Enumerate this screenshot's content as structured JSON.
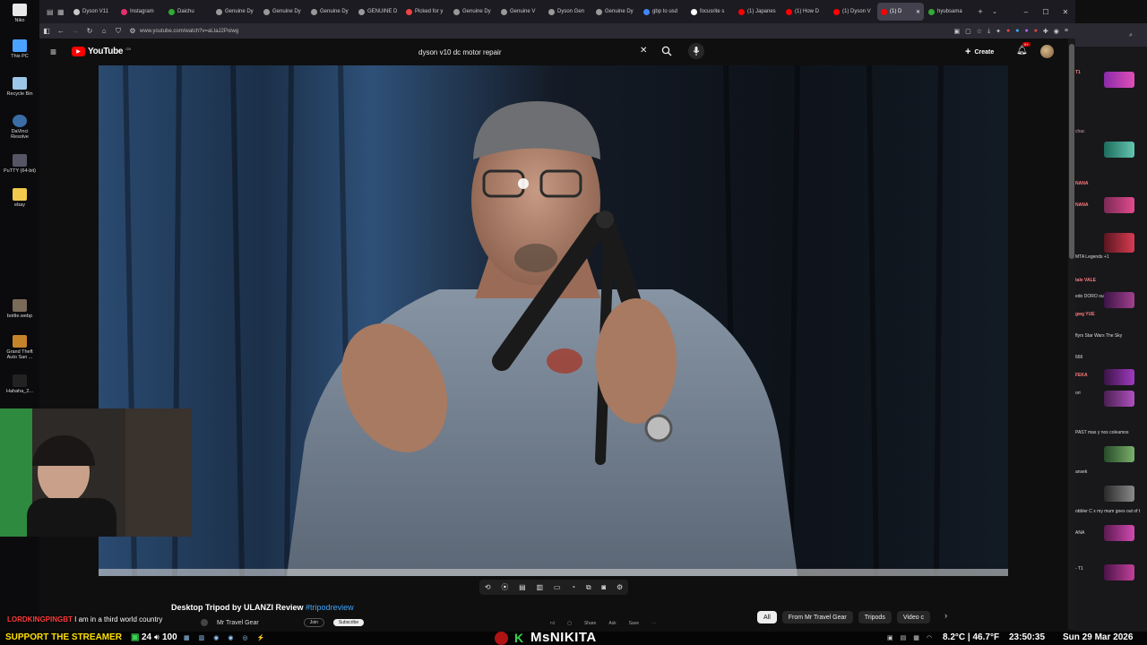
{
  "desktop": {
    "icons": [
      {
        "label": "Niko"
      },
      {
        "label": "This PC"
      },
      {
        "label": "Recycle Bin"
      },
      {
        "label": "DaVinci Resolve"
      },
      {
        "label": "PuTTY (64-bit)"
      },
      {
        "label": "ebay"
      },
      {
        "label": "bottle.webp"
      },
      {
        "label": "Grand Theft Auto San ..."
      },
      {
        "label": "Hahaha_2..."
      }
    ]
  },
  "browser": {
    "tabs": [
      {
        "label": "Dyson V11"
      },
      {
        "label": "Instagram"
      },
      {
        "label": "Daichu"
      },
      {
        "label": "Genuine Dy"
      },
      {
        "label": "Genuine Dy"
      },
      {
        "label": "Genuine Dy"
      },
      {
        "label": "GENUINE D"
      },
      {
        "label": "Picked for y"
      },
      {
        "label": "Genuine Dy"
      },
      {
        "label": "Genuine V"
      },
      {
        "label": "Dyson Gen"
      },
      {
        "label": "Genuine Dy"
      },
      {
        "label": "gbp to usd"
      },
      {
        "label": "focusrite s"
      },
      {
        "label": "(1) Japanes"
      },
      {
        "label": "(1) How D"
      },
      {
        "label": "(1) Dyson V"
      },
      {
        "label": "(1) D"
      },
      {
        "label": "hyubsama"
      }
    ],
    "url": "www.youtube.com/watch?v=aLIaJ2Poiwg"
  },
  "youtube": {
    "logo": "YouTube",
    "region": "GB",
    "search_value": "dyson v10  dc motor repair",
    "create_label": "Create",
    "notification_count": "9+",
    "video_title": "Desktop Tripod by ULANZI Review",
    "video_hashtag": "#tripodreview",
    "channel": "Mr Travel Gear",
    "join_label": "Join",
    "subscribe_label": "Subscribe",
    "share_label": "Share",
    "ask_label": "Ask",
    "save_label": "Save",
    "chips": [
      "All",
      "From Mr Travel Gear",
      "Tripods",
      "Video c"
    ]
  },
  "overlay": {
    "chat_user": "LORDKINGPINGBT",
    "chat_message": "I am in a third world country",
    "support_text": "SUPPORT THE STREAMER",
    "viewer_count": "24",
    "volume": "100",
    "streamer_name": "MsNIKITA",
    "weather": "8.2°C | 46.7°F",
    "time": "23:50:35",
    "date": "Sun 29 Mar 2026"
  },
  "chat_panel": {
    "entries": [
      {
        "text": "T1"
      },
      {
        "text": "chac"
      },
      {
        "text": "NANA"
      },
      {
        "text": "NANA"
      },
      {
        "text": "MTA  Legends +1"
      },
      {
        "text": "tale  VALE"
      },
      {
        "text": "edo  DORO  our luck"
      },
      {
        "text": "gwg  YUE"
      },
      {
        "text": "flyrs  Star Wars  The Sky"
      },
      {
        "text": "666"
      },
      {
        "text": "FEKA"
      },
      {
        "text": "ori"
      },
      {
        "text": "PAST  mas y nos coleamos"
      },
      {
        "text": "ansek"
      },
      {
        "text": "obbler  C x  my mum goes out of t"
      },
      {
        "text": "ANA"
      },
      {
        "text": "-  T1"
      }
    ]
  },
  "colors": {
    "accent_red": "#ff0000",
    "streamer_green": "#39d353",
    "support_yellow": "#ffe000",
    "chat_red": "#ff3b3b"
  }
}
